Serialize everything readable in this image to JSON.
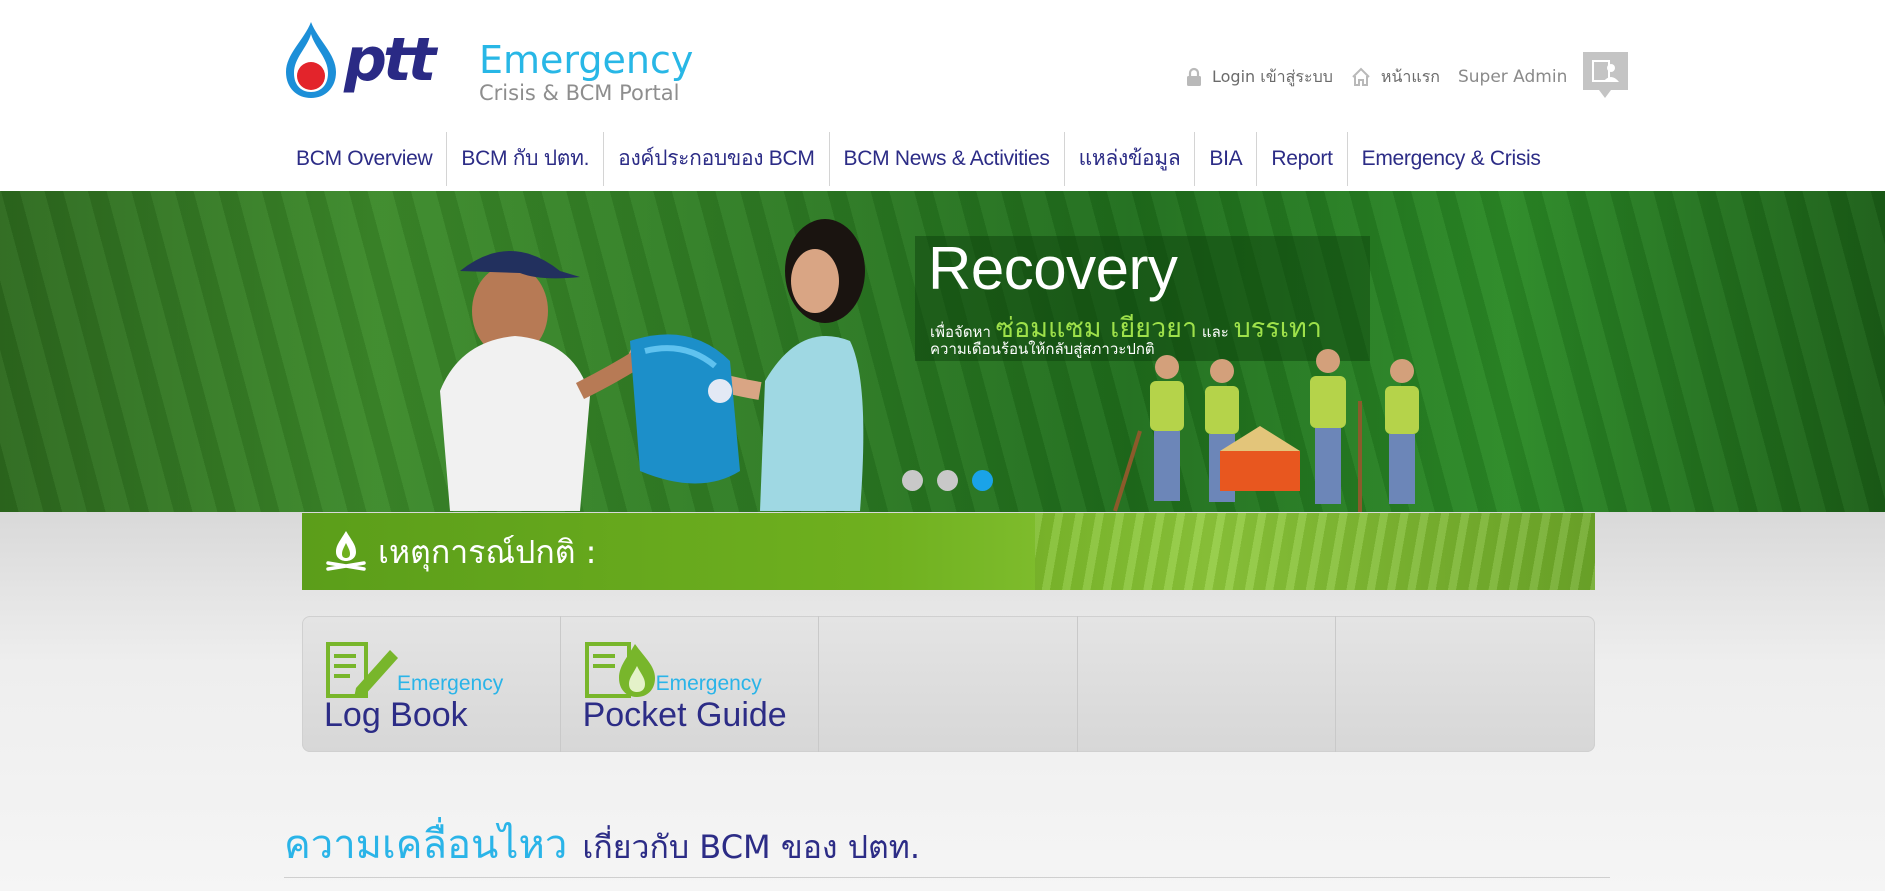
{
  "header": {
    "logo_word": "ptt",
    "portal_title_line1": "Emergency",
    "portal_title_line2": "Crisis & BCM Portal",
    "login_label": "Login เข้าสู่ระบบ",
    "home_label": "หน้าแรก",
    "user_name": "Super Admin"
  },
  "nav": {
    "items": [
      "BCM Overview",
      "BCM กับ ปตท.",
      "องค์ประกอบของ BCM",
      "BCM News & Activities",
      "แหล่งข้อมูล",
      "BIA",
      "Report",
      "Emergency & Crisis"
    ]
  },
  "banner": {
    "title": "Recovery",
    "sub_prefix": "เพื่อจัดหา",
    "sub_highlight1": "ซ่อมแซม เยียวยา",
    "sub_and": "และ",
    "sub_highlight2": "บรรเทา",
    "sub_line2": "ความเดือนร้อนให้กลับสู่สภาวะปกติ",
    "slide_count": 3,
    "active_slide": 3
  },
  "status": {
    "label": "เหตุการณ์ปกติ :"
  },
  "tools": [
    {
      "small": "Emergency",
      "big": "Log Book",
      "icon": "logbook-pencil-icon"
    },
    {
      "small": "Emergency",
      "big": "Pocket Guide",
      "icon": "pocket-guide-flame-icon"
    }
  ],
  "section": {
    "title_highlight": "ความเคลื่อนไหว",
    "title_rest": "เกี่ยวกับ BCM ของ ปตท."
  },
  "colors": {
    "brand_blue": "#2c2c86",
    "accent_cyan": "#2ab4e8",
    "status_green": "#6fb01f",
    "dot_active": "#1aa3e8"
  }
}
